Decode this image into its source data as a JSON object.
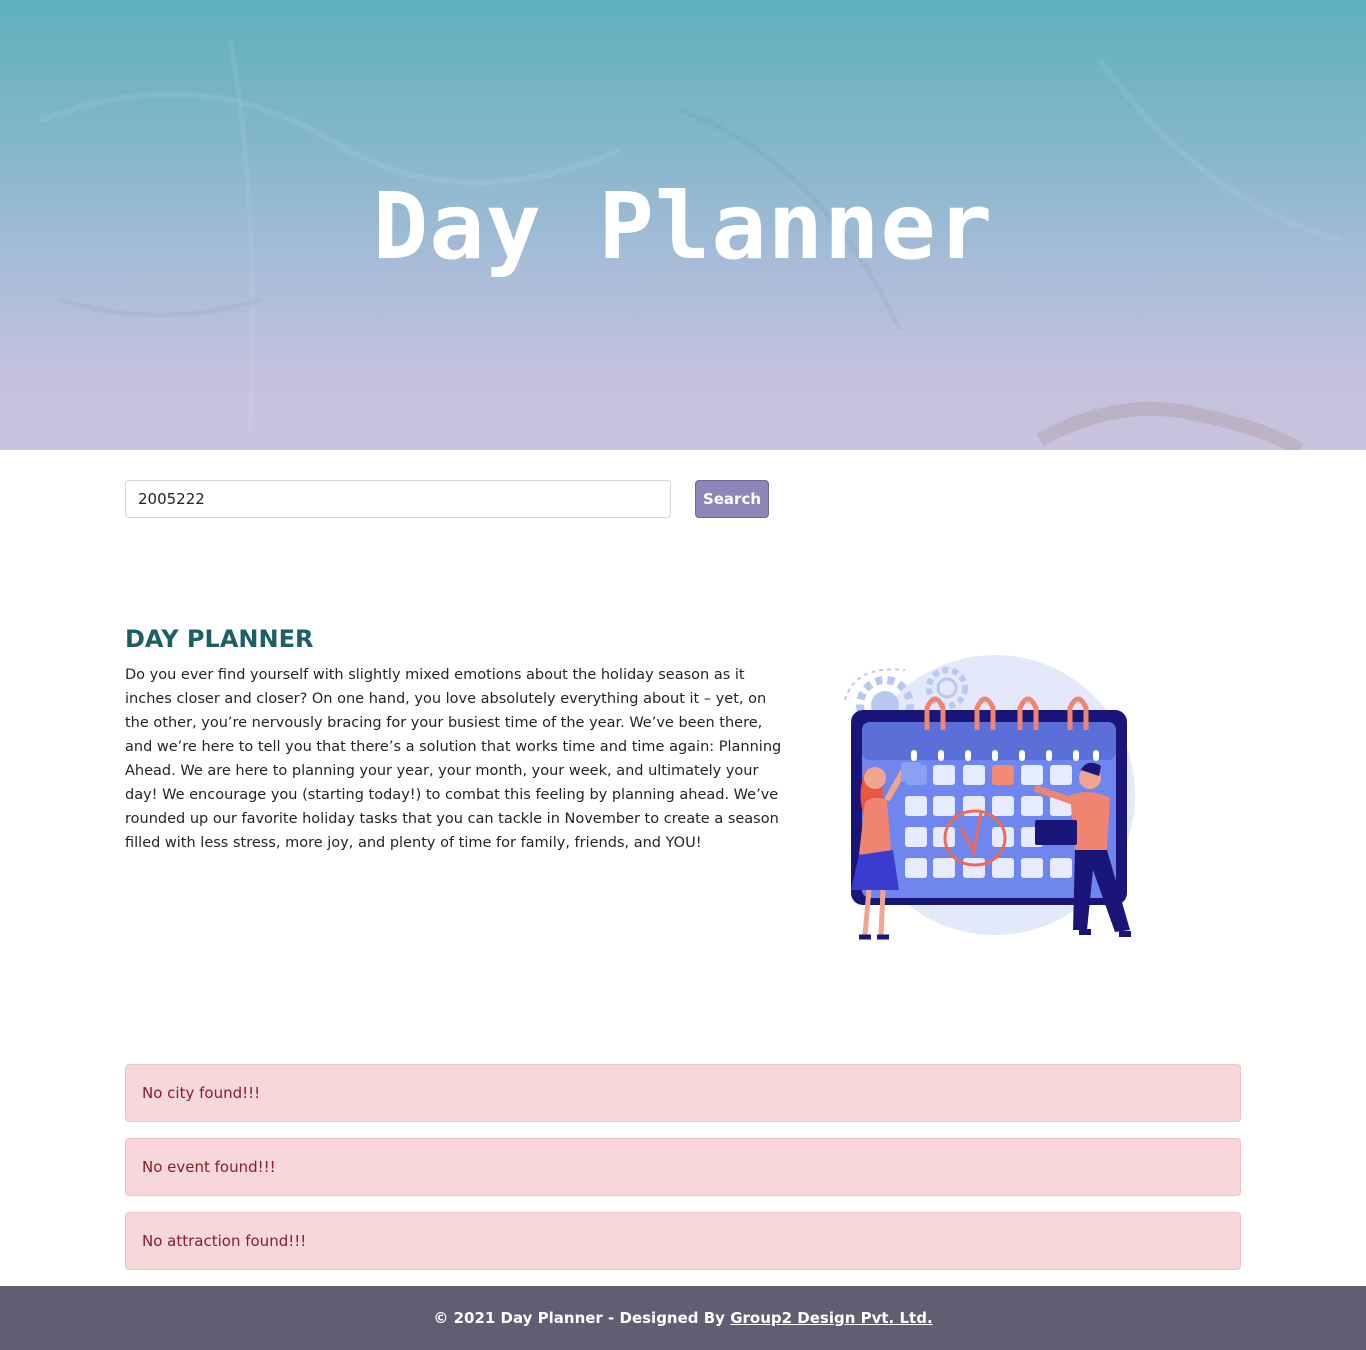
{
  "hero": {
    "title": "Day Planner"
  },
  "search": {
    "value": "2005222",
    "button_label": "Search"
  },
  "intro": {
    "heading": "DAY PLANNER",
    "body": "Do you ever find yourself with slightly mixed emotions about the holiday season as it inches closer and closer? On one hand, you love absolutely everything about it – yet, on the other, you’re nervously bracing for your busiest time of the year. We’ve been there, and we’re here to tell you that there’s a solution that works time and time again: Planning Ahead. We are here to planning your year, your month, your week, and ultimately your day! We encourage you (starting today!) to combat this feeling by planning ahead. We’ve rounded up our favorite holiday tasks that you can tackle in November to create a season filled with less stress, more joy, and plenty of time for family, friends, and YOU!"
  },
  "alerts": {
    "city": "No city found!!!",
    "event": "No event found!!!",
    "attraction": "No attraction found!!!"
  },
  "footer": {
    "prefix": "© 2021 Day Planner - Designed By ",
    "link_label": "Group2 Design Pvt. Ltd."
  },
  "colors": {
    "hero_top": "#5fb0bd",
    "hero_bottom": "#c9c3de",
    "button": "#8f85b8",
    "heading": "#1e5f66",
    "alert_bg": "#f8d7da",
    "alert_text": "#842029",
    "footer_bg": "#615d72"
  },
  "icons": {
    "illustration": "calendar-planning-illustration"
  }
}
